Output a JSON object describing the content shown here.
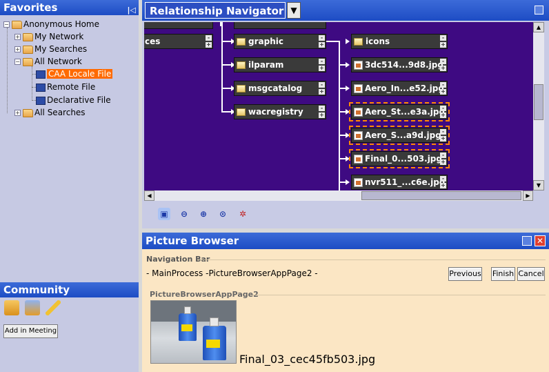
{
  "favorites": {
    "title": "Favorites",
    "collapse_icon": "|◁",
    "tree": [
      {
        "label": "Anonymous Home",
        "icon": "home-folder-icon"
      },
      {
        "label": "My Network",
        "icon": "folder-icon"
      },
      {
        "label": "My Searches",
        "icon": "folder-icon"
      },
      {
        "label": "All Network",
        "icon": "folder-icon"
      },
      {
        "label": "CAA Locale File",
        "icon": "computer-icon",
        "selected": true
      },
      {
        "label": "Remote File",
        "icon": "computer-icon"
      },
      {
        "label": "Declarative File",
        "icon": "computer-icon"
      },
      {
        "label": "All Searches",
        "icon": "folder-icon"
      }
    ]
  },
  "community": {
    "title": "Community",
    "add_meeting_label": "Add in Meeting",
    "icons": [
      "people-icon",
      "3d-people-icon",
      "pencil-icon"
    ]
  },
  "relationship_navigator": {
    "title": "Relationship Navigator",
    "dropdown_icon": "▼",
    "nodes_col1": [
      "ces"
    ],
    "nodes_col2": [
      "graphic",
      "ilparam",
      "msgcatalog",
      "wacregistry"
    ],
    "nodes_col3": [
      "icons",
      "3dc514...9d8.jpg",
      "Aero_In...e52.jpg",
      "Aero_St...e3a.jpg",
      "Aero_S...a9d.jpg",
      "Final_0...503.jpg",
      "nvr511_...c6e.jpg"
    ],
    "node_plus": "+",
    "node_minus": "-",
    "colors": {
      "canvas": "#3e0a82",
      "selection": "#ff8a00"
    }
  },
  "toolbar": {
    "icons": [
      "fit-all-icon",
      "zoom-out-icon",
      "zoom-in-icon",
      "center-icon",
      "layout-icon"
    ]
  },
  "picture_browser": {
    "title": "Picture Browser",
    "nav_bar_label": "Navigation Bar",
    "nav_path": "- MainProcess -PictureBrowserAppPage2 -",
    "previous_label": "Previous",
    "finish_label": "Finish",
    "cancel_label": "Cancel",
    "page_label": "PictureBrowserAppPage2",
    "image_name": "Final_03_cec45fb503.jpg",
    "close_icon": "✕"
  }
}
